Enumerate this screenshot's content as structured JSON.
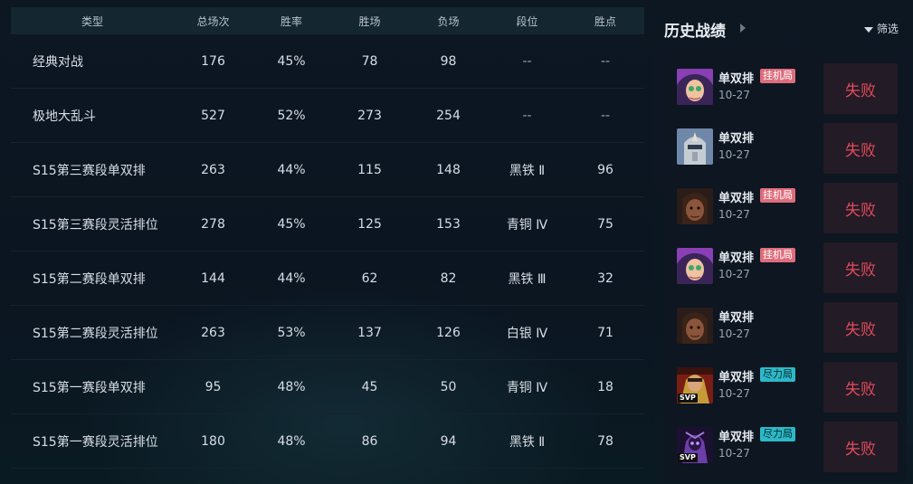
{
  "table": {
    "headers": [
      "类型",
      "总场次",
      "胜率",
      "胜场",
      "负场",
      "段位",
      "胜点"
    ],
    "rows": [
      [
        "经典对战",
        "176",
        "45%",
        "78",
        "98",
        "--",
        "--"
      ],
      [
        "极地大乱斗",
        "527",
        "52%",
        "273",
        "254",
        "--",
        "--"
      ],
      [
        "S15第三赛段单双排",
        "263",
        "44%",
        "115",
        "148",
        "黑铁 Ⅱ",
        "96"
      ],
      [
        "S15第三赛段灵活排位",
        "278",
        "45%",
        "125",
        "153",
        "青铜 Ⅳ",
        "75"
      ],
      [
        "S15第二赛段单双排",
        "144",
        "44%",
        "62",
        "82",
        "黑铁 Ⅲ",
        "32"
      ],
      [
        "S15第二赛段灵活排位",
        "263",
        "53%",
        "137",
        "126",
        "白银 Ⅳ",
        "71"
      ],
      [
        "S15第一赛段单双排",
        "95",
        "48%",
        "45",
        "50",
        "青铜 Ⅳ",
        "18"
      ],
      [
        "S15第一赛段灵活排位",
        "180",
        "48%",
        "86",
        "94",
        "黑铁 Ⅱ",
        "78"
      ]
    ]
  },
  "history": {
    "title": "历史战绩",
    "filter_label": "筛选",
    "matches": [
      {
        "mode": "单双排",
        "tag": "挂机局",
        "tag_type": "afk",
        "date": "10-27",
        "result": "失败",
        "champion_icon": "champion-portrait-purple-hair",
        "svp": ""
      },
      {
        "mode": "单双排",
        "tag": "",
        "tag_type": "",
        "date": "10-27",
        "result": "失败",
        "champion_icon": "champion-portrait-armored-knight",
        "svp": ""
      },
      {
        "mode": "单双排",
        "tag": "挂机局",
        "tag_type": "afk",
        "date": "10-27",
        "result": "失败",
        "champion_icon": "champion-portrait-dark-skin",
        "svp": ""
      },
      {
        "mode": "单双排",
        "tag": "挂机局",
        "tag_type": "afk",
        "date": "10-27",
        "result": "失败",
        "champion_icon": "champion-portrait-purple-hair",
        "svp": ""
      },
      {
        "mode": "单双排",
        "tag": "",
        "tag_type": "",
        "date": "10-27",
        "result": "失败",
        "champion_icon": "champion-portrait-dark-skin",
        "svp": ""
      },
      {
        "mode": "单双排",
        "tag": "尽力局",
        "tag_type": "try",
        "date": "10-27",
        "result": "失败",
        "champion_icon": "champion-portrait-red-warrior",
        "svp": "SVP"
      },
      {
        "mode": "单双排",
        "tag": "尽力局",
        "tag_type": "try",
        "date": "10-27",
        "result": "失败",
        "champion_icon": "champion-portrait-void-purple",
        "svp": "SVP"
      }
    ]
  },
  "colors": {
    "loss_text": "#e04b5d",
    "afk_tag": "#dd6d7c",
    "try_tag": "#2db8c7"
  }
}
